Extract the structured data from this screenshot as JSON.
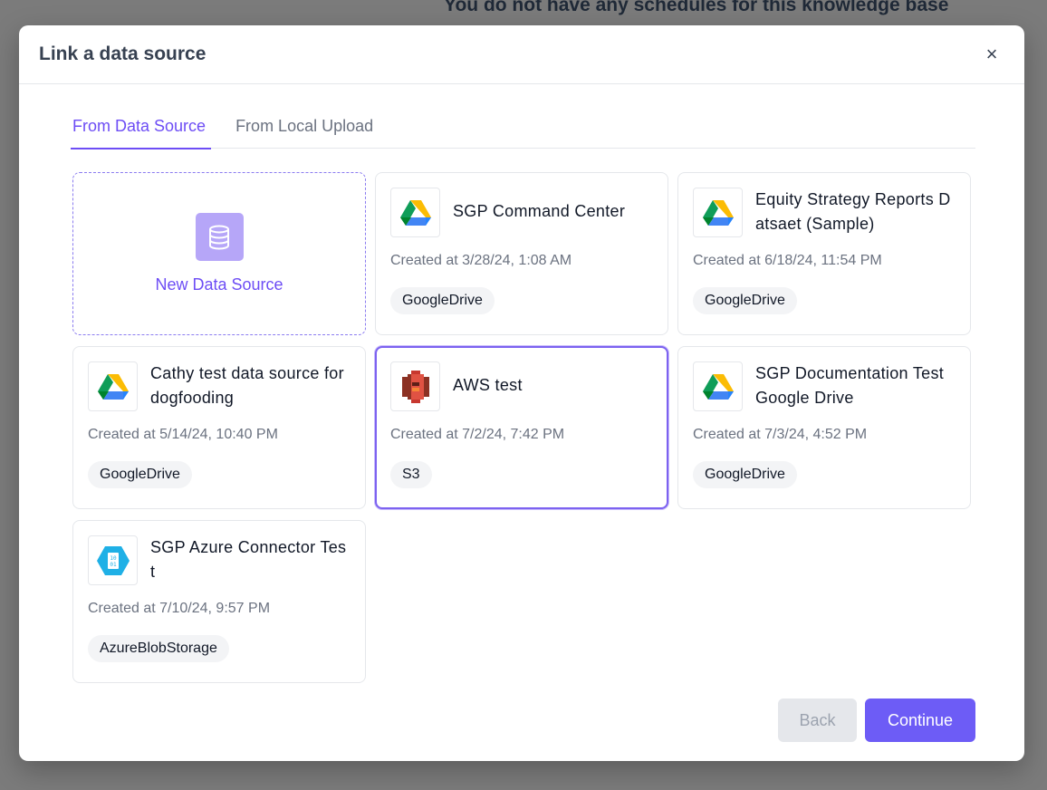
{
  "background": {
    "heading": "You do not have any schedules for this knowledge base"
  },
  "modal": {
    "title": "Link a data source",
    "close_symbol": "×"
  },
  "tabs": [
    {
      "label": "From Data Source",
      "active": true
    },
    {
      "label": "From Local Upload",
      "active": false
    }
  ],
  "new_source": {
    "label": "New Data Source",
    "icon": "database-icon"
  },
  "sources": [
    {
      "name": "SGP Command Center",
      "created": "Created at 3/28/24, 1:08 AM",
      "type": "GoogleDrive",
      "icon": "google-drive-icon"
    },
    {
      "name": "Equity Strategy Reports Datsaet (Sample)",
      "created": "Created at 6/18/24, 11:54 PM",
      "type": "GoogleDrive",
      "icon": "google-drive-icon"
    },
    {
      "name": "Cathy test data source for dogfooding",
      "created": "Created at 5/14/24, 10:40 PM",
      "type": "GoogleDrive",
      "icon": "google-drive-icon"
    },
    {
      "name": "AWS test",
      "created": "Created at 7/2/24, 7:42 PM",
      "type": "S3",
      "icon": "aws-s3-icon",
      "selected": true
    },
    {
      "name": "SGP Documentation Test Google Drive",
      "created": "Created at 7/3/24, 4:52 PM",
      "type": "GoogleDrive",
      "icon": "google-drive-icon"
    },
    {
      "name": "SGP Azure Connector Test",
      "created": "Created at 7/10/24, 9:57 PM",
      "type": "AzureBlobStorage",
      "icon": "azure-blob-icon"
    }
  ],
  "footer": {
    "back_label": "Back",
    "continue_label": "Continue"
  },
  "colors": {
    "accent": "#6d4df5",
    "overlay": "#7b7b7b",
    "s3": "#c7382f",
    "azure": "#1fb0e6"
  }
}
